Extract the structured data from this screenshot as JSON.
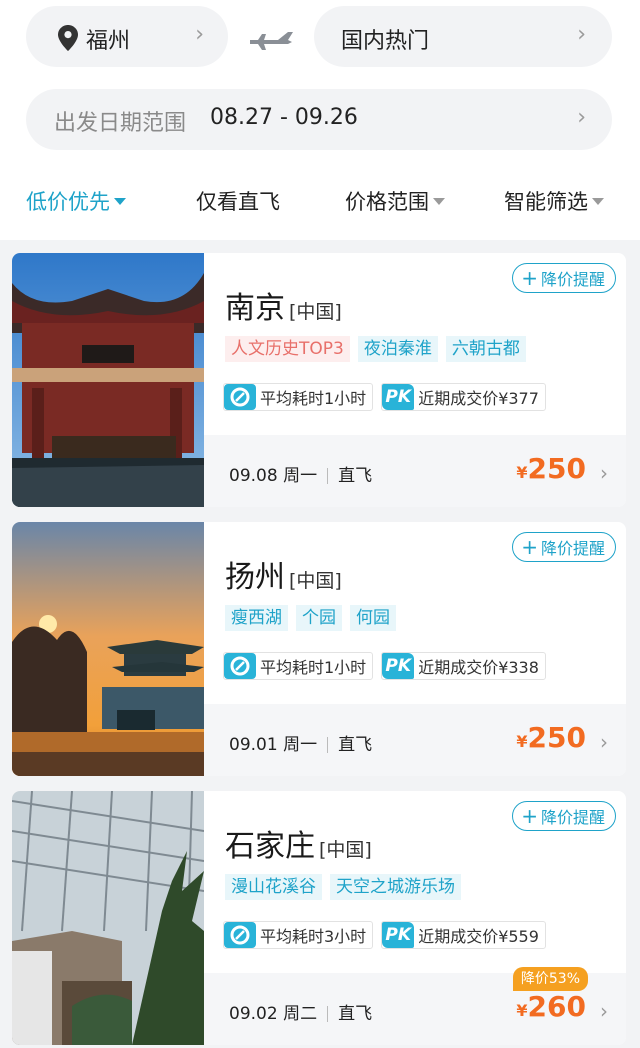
{
  "route": {
    "from_city": "福州",
    "to_region": "国内热门"
  },
  "date_range": {
    "label": "出发日期范围",
    "value": "08.27 - 09.26"
  },
  "filters": [
    {
      "label": "低价优先",
      "active": true
    },
    {
      "label": "仅看直飞",
      "active": false
    },
    {
      "label": "价格范围",
      "active": false
    },
    {
      "label": "智能筛选",
      "active": false
    }
  ],
  "cards": [
    {
      "city": "南京",
      "country": "[中国]",
      "remind_label": "降价提醒",
      "tags": [
        {
          "text": "人文历史TOP3",
          "style": "warm"
        },
        {
          "text": "夜泊秦淮",
          "style": "cool"
        },
        {
          "text": "六朝古都",
          "style": "cool"
        }
      ],
      "avg_time": "平均耗时1小时",
      "recent_price": "近期成交价¥377",
      "date": "09.08 周一",
      "flight_type": "直飞",
      "currency": "¥",
      "price": "250",
      "drop_badge": ""
    },
    {
      "city": "扬州",
      "country": "[中国]",
      "remind_label": "降价提醒",
      "tags": [
        {
          "text": "瘦西湖",
          "style": "cool"
        },
        {
          "text": "个园",
          "style": "cool"
        },
        {
          "text": "何园",
          "style": "cool"
        }
      ],
      "avg_time": "平均耗时1小时",
      "recent_price": "近期成交价¥338",
      "date": "09.01 周一",
      "flight_type": "直飞",
      "currency": "¥",
      "price": "250",
      "drop_badge": ""
    },
    {
      "city": "石家庄",
      "country": "[中国]",
      "remind_label": "降价提醒",
      "tags": [
        {
          "text": "漫山花溪谷",
          "style": "cool"
        },
        {
          "text": "天空之城游乐场",
          "style": "cool"
        }
      ],
      "avg_time": "平均耗时3小时",
      "recent_price": "近期成交价¥559",
      "date": "09.02 周二",
      "flight_type": "直飞",
      "currency": "¥",
      "price": "260",
      "drop_badge": "降价53%"
    }
  ],
  "pk_label": "PK",
  "colors": {
    "accent": "#1fa3c9",
    "price": "#f26b21",
    "drop_badge": "#f5a020",
    "warm_tag": "#e8706a"
  }
}
